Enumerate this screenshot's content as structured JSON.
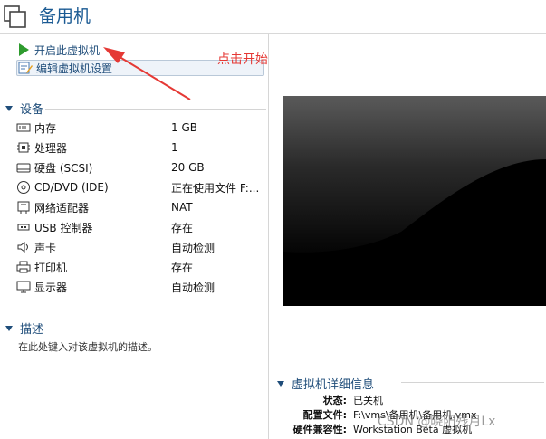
{
  "window": {
    "title": "备用机"
  },
  "actions": {
    "start_label": "开启此虚拟机",
    "edit_label": "编辑虚拟机设置"
  },
  "devices": {
    "header": "设备",
    "items": [
      {
        "icon": "memory-icon",
        "name": "内存",
        "value": "1 GB"
      },
      {
        "icon": "cpu-icon",
        "name": "处理器",
        "value": "1"
      },
      {
        "icon": "harddisk-icon",
        "name": "硬盘 (SCSI)",
        "value": "20 GB"
      },
      {
        "icon": "cd-dvd-icon",
        "name": "CD/DVD (IDE)",
        "value": "正在使用文件 F:..."
      },
      {
        "icon": "network-adapter-icon",
        "name": "网络适配器",
        "value": "NAT"
      },
      {
        "icon": "usb-icon",
        "name": "USB 控制器",
        "value": "存在"
      },
      {
        "icon": "sound-icon",
        "name": "声卡",
        "value": "自动检测"
      },
      {
        "icon": "printer-icon",
        "name": "打印机",
        "value": "存在"
      },
      {
        "icon": "display-icon",
        "name": "显示器",
        "value": "自动检测"
      }
    ]
  },
  "description": {
    "header": "描述",
    "placeholder": "在此处键入对该虚拟机的描述。"
  },
  "annotation": {
    "text": "点击开始",
    "color": "#e53935"
  },
  "details": {
    "header": "虚拟机详细信息",
    "rows": [
      {
        "key": "状态:",
        "value": "已关机"
      },
      {
        "key": "配置文件:",
        "value": "F:\\vms\\备用机\\备用机.vmx"
      },
      {
        "key": "硬件兼容性:",
        "value": "Workstation Beta 虚拟机"
      }
    ]
  },
  "watermark": "CSDN @晓阳残月Lx",
  "colors": {
    "link": "#1f4d7a",
    "start_green": "#2e9b2e",
    "annotation_red": "#e53935"
  }
}
